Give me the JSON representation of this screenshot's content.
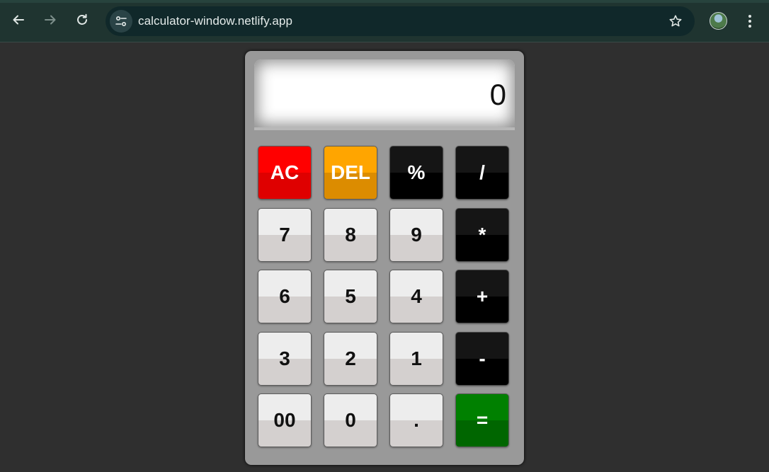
{
  "browser": {
    "url": "calculator-window.netlify.app"
  },
  "icons": {
    "back": "arrow-left-icon",
    "forward": "arrow-right-icon",
    "reload": "reload-icon",
    "site_info": "tune-icon",
    "bookmark": "star-icon",
    "menu": "kebab-menu-icon"
  },
  "calculator": {
    "display": "0",
    "keys": {
      "ac": "AC",
      "del": "DEL",
      "percent": "%",
      "divide": "/",
      "seven": "7",
      "eight": "8",
      "nine": "9",
      "multiply": "*",
      "six": "6",
      "five": "5",
      "four": "4",
      "plus": "+",
      "three": "3",
      "two": "2",
      "one": "1",
      "minus": "-",
      "double_zero": "00",
      "zero": "0",
      "dot": ".",
      "equals": "="
    }
  },
  "colors": {
    "page_background": "#2f2f2f",
    "browser_toolbar": "#1f3430",
    "omnibox": "#10282a",
    "calculator_body": "#999999",
    "key_ac": "#ff0000",
    "key_del": "#ffa500",
    "key_equals": "#008000",
    "key_operator": "#000000",
    "key_digit": "#ededed"
  }
}
